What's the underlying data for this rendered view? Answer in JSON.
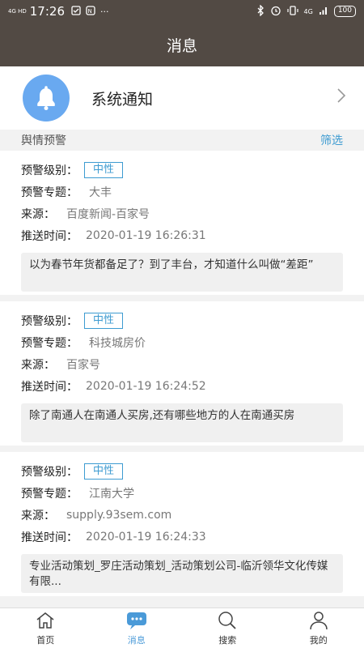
{
  "status_bar": {
    "signal": "4G HD",
    "time": "17:26",
    "icons": [
      "sim-icon",
      "nfc-icon",
      "more-dots-icon"
    ],
    "more": "···",
    "network": "4G",
    "battery": "100"
  },
  "header": {
    "title": "消息"
  },
  "system_notice": {
    "label": "系统通知",
    "icon": "bell-icon"
  },
  "section": {
    "title": "舆情预警",
    "filter": "筛选"
  },
  "labels": {
    "level": "预警级别：",
    "topic": "预警专题：",
    "source": "来源：",
    "time": "推送时间："
  },
  "alerts": [
    {
      "level": "中性",
      "topic": "大丰",
      "source": "百度新闻-百家号",
      "time": "2020-01-19 16:26:31",
      "snippet": "以为春节年货都备足了？到了丰台，才知道什么叫做“差距”"
    },
    {
      "level": "中性",
      "topic": "科技城房价",
      "source": "百家号",
      "time": "2020-01-19 16:24:52",
      "snippet": "除了南通人在南通人买房,还有哪些地方的人在南通买房"
    },
    {
      "level": "中性",
      "topic": "江南大学",
      "source": "supply.93sem.com",
      "time": "2020-01-19 16:24:33",
      "snippet": "专业活动策划_罗庄活动策划_活动策划公司-临沂领华文化传媒有限..."
    }
  ],
  "bottom_nav": [
    {
      "label": "首页",
      "icon": "home-icon",
      "active": false
    },
    {
      "label": "消息",
      "icon": "chat-icon",
      "active": true
    },
    {
      "label": "搜索",
      "icon": "search-icon",
      "active": false
    },
    {
      "label": "我的",
      "icon": "user-icon",
      "active": false
    }
  ],
  "colors": {
    "header_bg": "#524a44",
    "accent": "#3d9bd1",
    "active_tab": "#4a9ad8",
    "bell_bg": "#69a9f0"
  }
}
